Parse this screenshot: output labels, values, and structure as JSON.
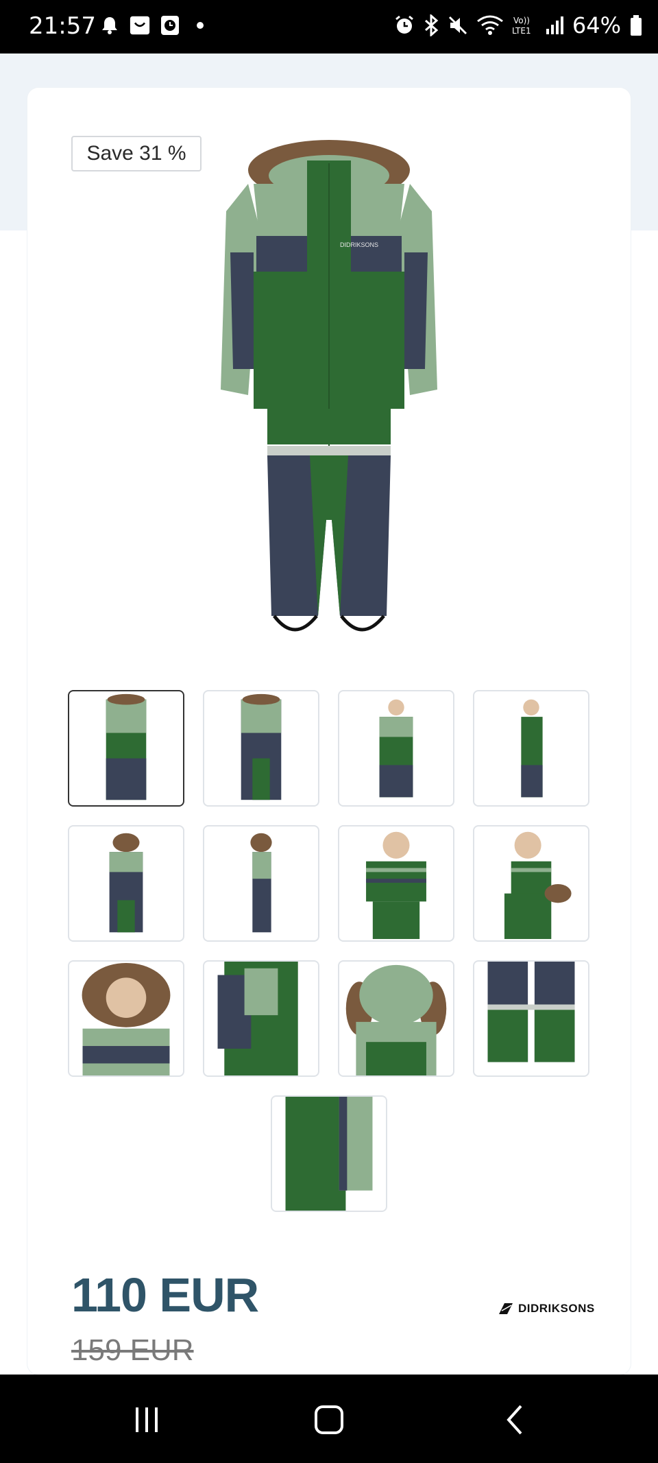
{
  "status_bar": {
    "time": "21:57",
    "battery": "64%",
    "icons": [
      "notification-bell-icon",
      "app-icon",
      "app-clock-icon",
      "dot-icon",
      "alarm-icon",
      "bluetooth-icon",
      "mute-icon",
      "wifi-icon",
      "volte-icon",
      "signal-icon",
      "battery-icon"
    ]
  },
  "product": {
    "badge": "Save 31 %",
    "price": "110 EUR",
    "old_price": "159 EUR",
    "brand": "DIDRIKSONS",
    "selected_thumbnail_index": 0,
    "thumbnail_count": 13
  },
  "colors": {
    "accent_price": "#2f5468",
    "jacket_green": "#2e6b33",
    "light_green": "#8fb08f",
    "navy": "#3a4358",
    "fur": "#7a5a3e"
  },
  "nav": {
    "icons": [
      "recent-apps-icon",
      "home-icon",
      "back-icon"
    ]
  }
}
